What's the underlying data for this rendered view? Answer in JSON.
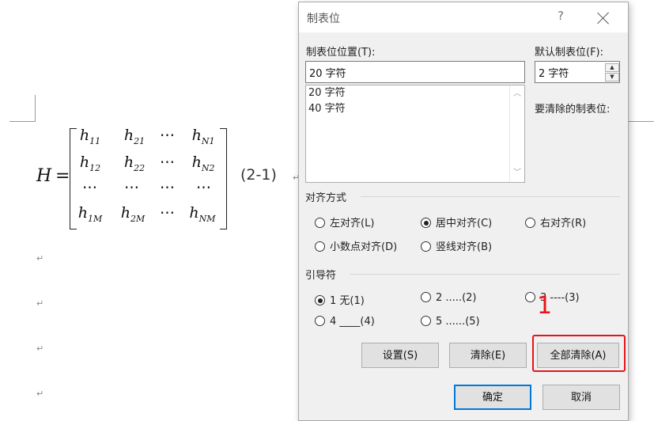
{
  "document": {
    "equation": {
      "lhs": "H",
      "eq": "=",
      "rows": [
        [
          {
            "b": "h",
            "s": "11"
          },
          {
            "b": "h",
            "s": "21"
          },
          {
            "b": "⋯",
            "s": ""
          },
          {
            "b": "h",
            "s": "N1"
          }
        ],
        [
          {
            "b": "h",
            "s": "12"
          },
          {
            "b": "h",
            "s": "22"
          },
          {
            "b": "⋯",
            "s": ""
          },
          {
            "b": "h",
            "s": "N2"
          }
        ],
        [
          {
            "b": "⋯",
            "s": ""
          },
          {
            "b": "⋯",
            "s": ""
          },
          {
            "b": "⋯",
            "s": ""
          },
          {
            "b": "⋯",
            "s": ""
          }
        ],
        [
          {
            "b": "h",
            "s": "1M"
          },
          {
            "b": "h",
            "s": "2M"
          },
          {
            "b": "⋯",
            "s": ""
          },
          {
            "b": "h",
            "s": "NM"
          }
        ]
      ],
      "number": "(2-1)"
    },
    "paragraph_mark": "↵"
  },
  "dialog": {
    "title": "制表位",
    "help": "?",
    "tab_stop_position_label": "制表位位置(T):",
    "tab_stop_position_value": "20 字符",
    "tab_stop_list": [
      "20 字符",
      "40 字符"
    ],
    "default_tab_label": "默认制表位(F):",
    "default_tab_value": "2 字符",
    "to_clear_label": "要清除的制表位:",
    "alignment": {
      "title": "对齐方式",
      "options": [
        {
          "label": "左对齐(L)",
          "checked": false
        },
        {
          "label": "居中对齐(C)",
          "checked": true
        },
        {
          "label": "右对齐(R)",
          "checked": false
        },
        {
          "label": "小数点对齐(D)",
          "checked": false
        },
        {
          "label": "竖线对齐(B)",
          "checked": false
        }
      ]
    },
    "leader": {
      "title": "引导符",
      "options": [
        {
          "label": "1 无(1)",
          "checked": true
        },
        {
          "label": "2 .....(2)",
          "checked": false
        },
        {
          "label": "3 ----(3)",
          "checked": false
        },
        {
          "label": "4 ____(4)",
          "checked": false
        },
        {
          "label": "5 ......(5)",
          "checked": false
        }
      ]
    },
    "buttons": {
      "set": "设置(S)",
      "clear": "清除(E)",
      "clear_all": "全部清除(A)",
      "ok": "确定",
      "cancel": "取消"
    },
    "annotation_number": "1",
    "accent_color": "#0078d7",
    "annotation_color": "#e8141a"
  }
}
